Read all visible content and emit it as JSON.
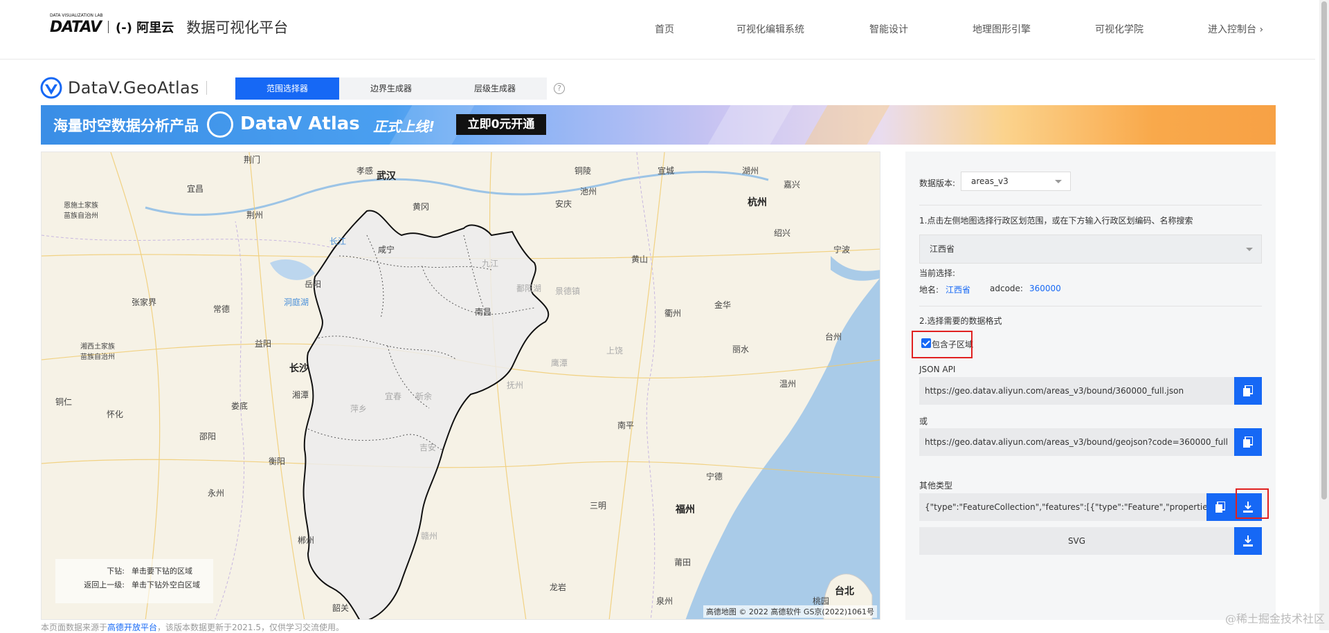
{
  "top_nav": {
    "logo_mark": "DATAV",
    "logo_sub": "DATA VISUALIZATION LAB",
    "aliyun": "(-) 阿里云",
    "platform": "数据可视化平台",
    "items": [
      "首页",
      "可视化编辑系统",
      "智能设计",
      "地理图形引擎",
      "可视化学院",
      "进入控制台 ›"
    ]
  },
  "product": {
    "name": "DataV.GeoAtlas",
    "tabs": [
      "范围选择器",
      "边界生成器",
      "层级生成器"
    ],
    "help": "?"
  },
  "banner": {
    "text1": "海量时空数据分析产品",
    "text2": "DataV Atlas",
    "text3": "正式上线!",
    "cta": "立即0元开通"
  },
  "map": {
    "labels": {
      "jingmen": "荆门",
      "xiaogan": "孝感",
      "wuhan": "武汉",
      "tongling": "铜陵",
      "xuancheng": "宣城",
      "huzhou": "湖州",
      "jiaxing": "嘉兴",
      "yichang": "宜昌",
      "enshi": "恩施土家族\n苗族自治州",
      "jingzhou": "荆州",
      "huanggang": "黄冈",
      "anqing": "安庆",
      "chizhou": "池州",
      "hangzhou": "杭州",
      "shaoxing": "绍兴",
      "changjiang": "长江",
      "xianning": "咸宁",
      "huangshan": "黄山",
      "ningbo": "宁波",
      "yueyang": "岳阳",
      "jiujiang": "九江",
      "poyang": "鄱阳湖",
      "jingdezhen": "景德镇",
      "zhangjiajie": "张家界",
      "dongting": "洞庭湖",
      "changde": "常德",
      "nanchang": "南昌",
      "quzhou": "衢州",
      "jinhua": "金华",
      "xiangxi": "湘西土家族\n苗族自治州",
      "yiyang": "益阳",
      "shangrao": "上饶",
      "lishui": "丽水",
      "taizhou": "台州",
      "changsha": "长沙",
      "yingtan": "鹰潭",
      "fuzhoujx": "抚州",
      "wenzhou": "温州",
      "tongren": "铜仁",
      "xiangtan": "湘潭",
      "yichun": "宜春",
      "xinyu": "新余",
      "pingxiang": "萍乡",
      "huaihua": "怀化",
      "loudi": "娄底",
      "nanping": "南平",
      "shaoyang": "邵阳",
      "hengyang": "衡阳",
      "jian": "吉安",
      "ningde": "宁德",
      "yongzhou": "永州",
      "sanming": "三明",
      "fuzhou": "福州",
      "chenzhou": "郴州",
      "ganzhou": "赣州",
      "putian": "莆田",
      "longyan": "龙岩",
      "quanzhou": "泉州",
      "taibei": "台北",
      "taoyuan": "桃园",
      "shaoguan": "韶关"
    },
    "help": {
      "down_key": "下钻:",
      "down_val": "单击要下钻的区域",
      "up_key": "返回上一级:",
      "up_val": "单击下钻外空白区域"
    },
    "attribution": "高德地图 © 2022 高德软件 GS京(2022)1061号"
  },
  "footer_note": {
    "prefix": "本页面数据来源于",
    "link": "高德开放平台",
    "suffix": "，该版本数据更新于2021.5，仅供学习交流使用。"
  },
  "panel": {
    "version_label": "数据版本:",
    "version_value": "areas_v3",
    "step1": "1.点击左侧地图选择行政区划范围，或在下方输入行政区划编码、名称搜索",
    "region_value": "江西省",
    "current_label": "当前选择:",
    "name_label": "地名:",
    "name_value": "江西省",
    "adcode_label": "adcode:",
    "adcode_value": "360000",
    "step2": "2.选择需要的数据格式",
    "include_sub": "包含子区域",
    "json_api_label": "JSON API",
    "json_api_url": "https://geo.datav.aliyun.com/areas_v3/bound/360000_full.json",
    "or_label": "或",
    "geojson_url": "https://geo.datav.aliyun.com/areas_v3/bound/geojson?code=360000_full",
    "other_label": "其他类型",
    "other_value": "{\"type\":\"FeatureCollection\",\"features\":[{\"type\":\"Feature\",\"properties\":{\"a",
    "svg_label": "SVG"
  },
  "watermark": "@稀土掘金技术社区"
}
